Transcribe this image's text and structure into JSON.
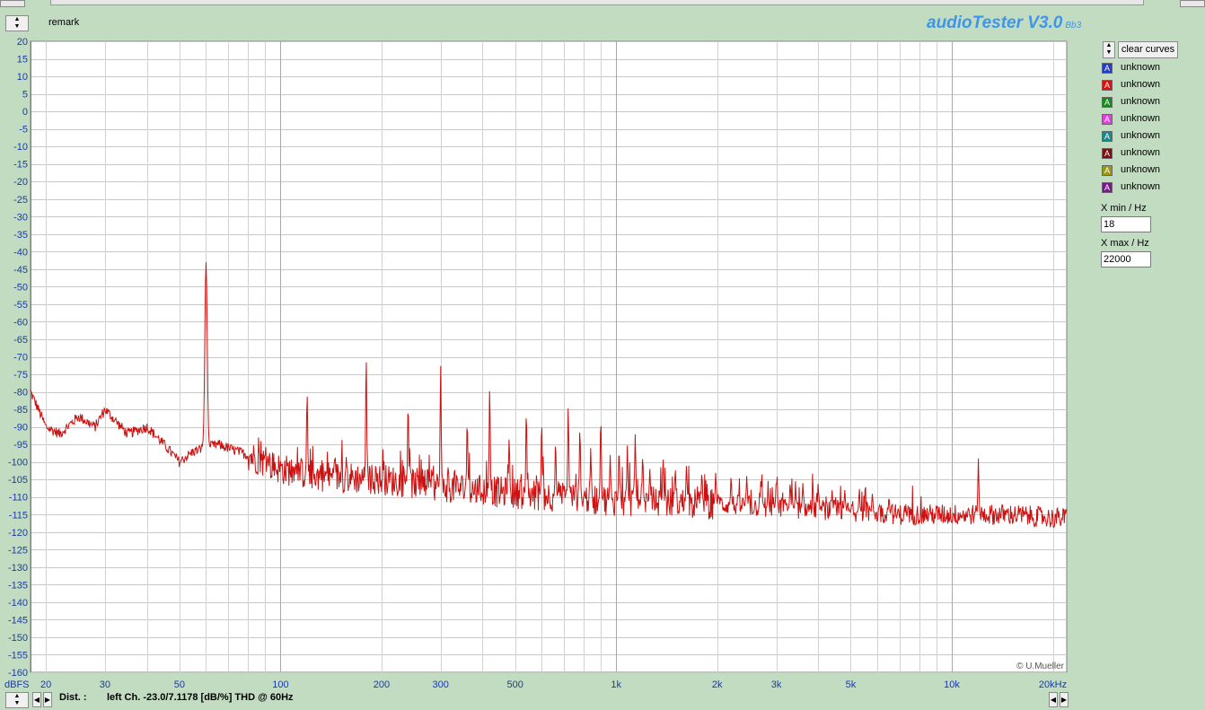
{
  "app": {
    "title": "audioTester V3.0",
    "version_note": "Bb3",
    "remark_label": "remark"
  },
  "copyright": "© U.Mueller",
  "legend": {
    "clear_button": "clear curves",
    "items": [
      {
        "label": "unknown",
        "color": "#1f3fd0"
      },
      {
        "label": "unknown",
        "color": "#e01010"
      },
      {
        "label": "unknown",
        "color": "#1a8a1a"
      },
      {
        "label": "unknown",
        "color": "#e040e0"
      },
      {
        "label": "unknown",
        "color": "#1a8a8a"
      },
      {
        "label": "unknown",
        "color": "#7a1010"
      },
      {
        "label": "unknown",
        "color": "#9a9a10"
      },
      {
        "label": "unknown",
        "color": "#7a1a8a"
      }
    ]
  },
  "axis_controls": {
    "xmin_label": "X min / Hz",
    "xmin_value": "18",
    "xmax_label": "X max / Hz",
    "xmax_value": "22000"
  },
  "status": {
    "dist_label": "Dist. :",
    "text": "left Ch. -23.0/7.1178 [dB/%] THD @ 60Hz"
  },
  "chart_data": {
    "type": "line",
    "x_scale": "log",
    "xlim": [
      18,
      22000
    ],
    "ylim": [
      -160,
      20
    ],
    "ylabel": "dBFS",
    "x_ticks": [
      20,
      30,
      50,
      100,
      200,
      300,
      500,
      1000,
      2000,
      3000,
      5000,
      10000,
      20000
    ],
    "x_tick_labels": [
      "20",
      "30",
      "50",
      "100",
      "200",
      "300",
      "500",
      "1k",
      "2k",
      "3k",
      "5k",
      "10k",
      "20kHz"
    ],
    "y_ticks": [
      20,
      15,
      10,
      5,
      0,
      -5,
      -10,
      -15,
      -20,
      -25,
      -30,
      -35,
      -40,
      -45,
      -50,
      -55,
      -60,
      -65,
      -70,
      -75,
      -80,
      -85,
      -90,
      -95,
      -100,
      -105,
      -110,
      -115,
      -120,
      -125,
      -130,
      -135,
      -140,
      -145,
      -150,
      -155,
      -160
    ],
    "grid": true,
    "series": [
      {
        "color": "#cc1111",
        "noise_floor": [
          [
            18,
            -80
          ],
          [
            19,
            -85
          ],
          [
            20,
            -90
          ],
          [
            22,
            -92
          ],
          [
            25,
            -87
          ],
          [
            28,
            -90
          ],
          [
            30,
            -85
          ],
          [
            35,
            -92
          ],
          [
            40,
            -90
          ],
          [
            45,
            -95
          ],
          [
            50,
            -100
          ],
          [
            55,
            -97
          ],
          [
            65,
            -95
          ],
          [
            80,
            -98
          ],
          [
            100,
            -102
          ],
          [
            130,
            -104
          ],
          [
            200,
            -105
          ],
          [
            300,
            -107
          ],
          [
            500,
            -109
          ],
          [
            1000,
            -111
          ],
          [
            2000,
            -112
          ],
          [
            3000,
            -113
          ],
          [
            5000,
            -114
          ],
          [
            7000,
            -115
          ],
          [
            10000,
            -115
          ],
          [
            15000,
            -115
          ],
          [
            20000,
            -116
          ],
          [
            22000,
            -116
          ]
        ],
        "peaks": [
          [
            60,
            -43
          ],
          [
            120,
            -80
          ],
          [
            180,
            -69
          ],
          [
            240,
            -83
          ],
          [
            300,
            -72
          ],
          [
            360,
            -88
          ],
          [
            420,
            -78
          ],
          [
            480,
            -93
          ],
          [
            540,
            -85
          ],
          [
            600,
            -88
          ],
          [
            660,
            -94
          ],
          [
            720,
            -84
          ],
          [
            780,
            -90
          ],
          [
            840,
            -96
          ],
          [
            900,
            -87
          ],
          [
            960,
            -98
          ],
          [
            1020,
            -96
          ],
          [
            1080,
            -95
          ],
          [
            1140,
            -92
          ],
          [
            1200,
            -98
          ],
          [
            1260,
            -102
          ],
          [
            1380,
            -99
          ],
          [
            1500,
            -102
          ],
          [
            1620,
            -101
          ],
          [
            1800,
            -103
          ],
          [
            1980,
            -103
          ],
          [
            2200,
            -104
          ],
          [
            2450,
            -104
          ],
          [
            2700,
            -105
          ],
          [
            3000,
            -105
          ],
          [
            3300,
            -106
          ],
          [
            3600,
            -106
          ],
          [
            4000,
            -107
          ],
          [
            4400,
            -108
          ],
          [
            4800,
            -108
          ],
          [
            5300,
            -109
          ],
          [
            5800,
            -109
          ],
          [
            6500,
            -110
          ],
          [
            12000,
            -99
          ]
        ]
      }
    ]
  }
}
